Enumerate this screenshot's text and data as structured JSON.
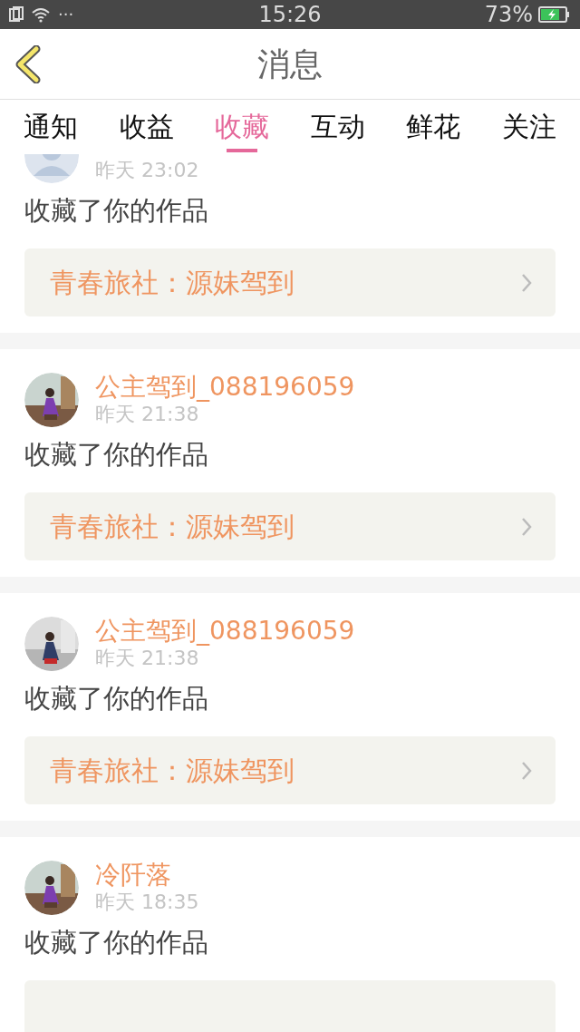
{
  "status_bar": {
    "time": "15:26",
    "battery": "73%",
    "more": "···"
  },
  "header": {
    "title": "消息"
  },
  "tabs": [
    {
      "label": "通知",
      "selected": false
    },
    {
      "label": "收益",
      "selected": false
    },
    {
      "label": "收藏",
      "selected": true
    },
    {
      "label": "互动",
      "selected": false
    },
    {
      "label": "鲜花",
      "selected": false
    },
    {
      "label": "关注",
      "selected": false
    }
  ],
  "messages": [
    {
      "avatar": {
        "kind": "default"
      },
      "time": "昨天 23:02",
      "action": "收藏了你的作品",
      "work": "青春旅社：源妹驾到"
    },
    {
      "name": "公主驾到_088196059",
      "time": "昨天 21:38",
      "action": "收藏了你的作品",
      "work": "青春旅社：源妹驾到"
    },
    {
      "name": "公主驾到_088196059",
      "time": "昨天 21:38",
      "action": "收藏了你的作品",
      "work": "青春旅社：源妹驾到"
    },
    {
      "name": "冷阡落",
      "time": "昨天 18:35",
      "action": "收藏了你的作品"
    }
  ]
}
